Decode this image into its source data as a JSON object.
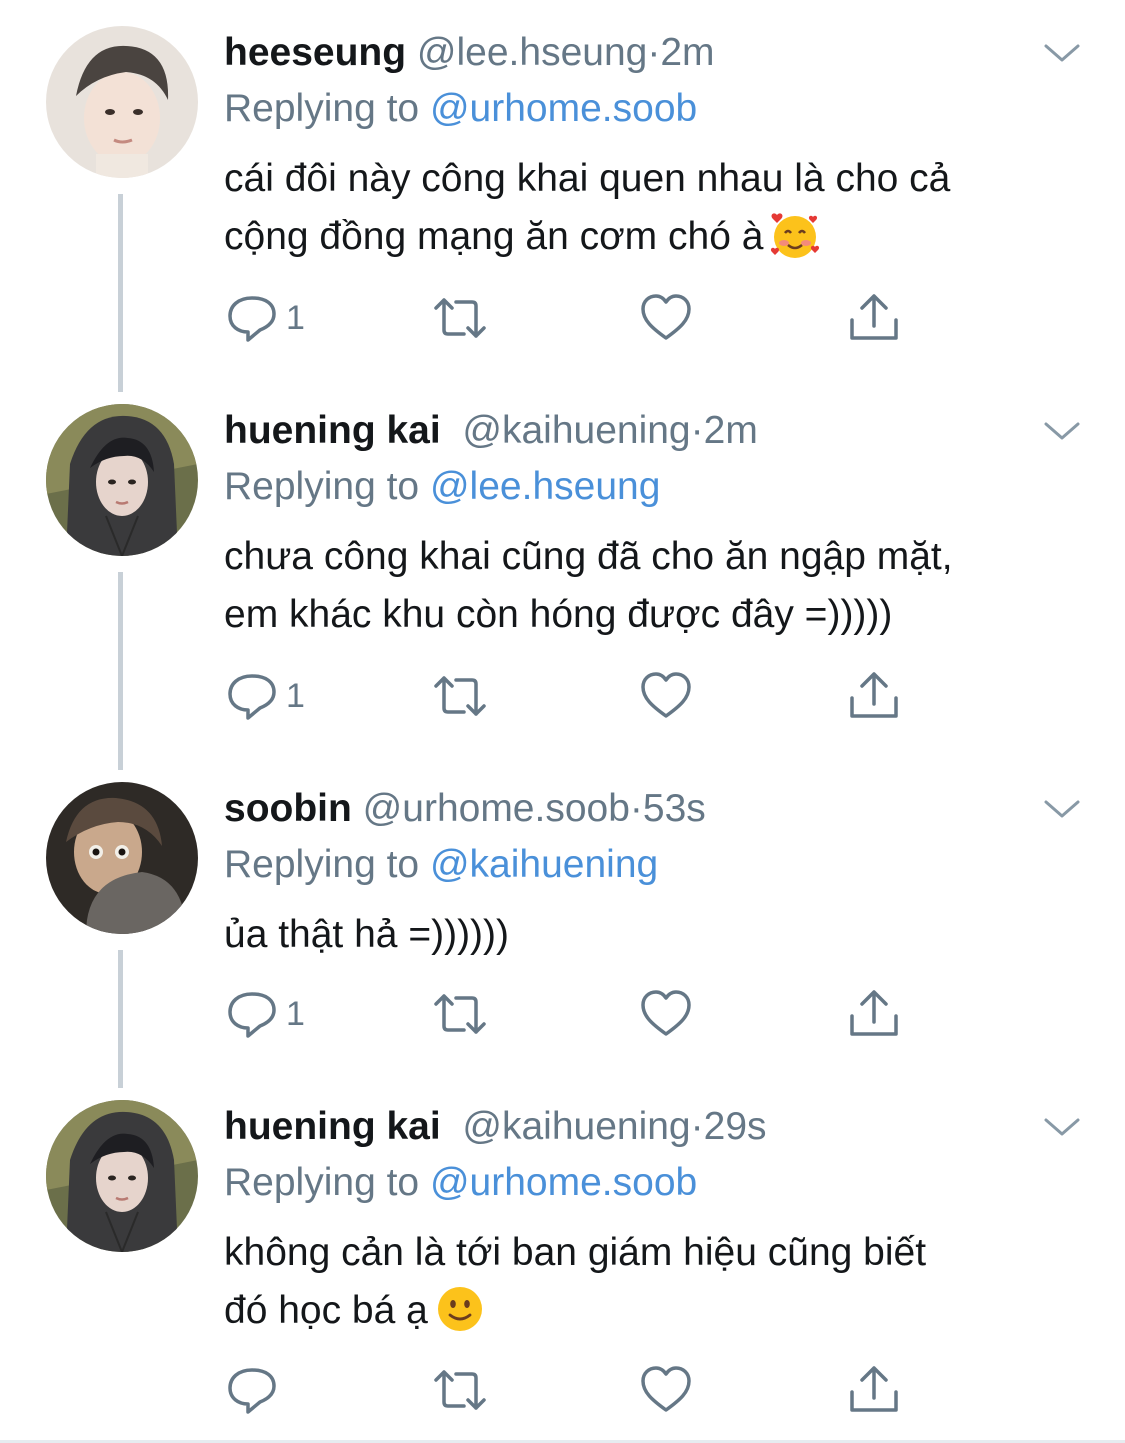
{
  "colors": {
    "name": "#14171a",
    "muted": "#657786",
    "link": "#4a90d9",
    "thread_line": "#c8d0d7"
  },
  "icons": {
    "reply": "reply-icon",
    "retweet": "retweet-icon",
    "like": "heart-icon",
    "share": "share-icon",
    "more": "chevron-down-icon"
  },
  "tweets": [
    {
      "name": "heeseung",
      "handle": "@lee.hseung",
      "dot": "·",
      "time": "2m",
      "replying_prefix": "Replying to",
      "replying_to": "@urhome.soob",
      "text_lines": [
        "cái đôi này công khai quen nhau là cho cả",
        "cộng đồng mạng ăn cơm chó à"
      ],
      "emoji": "smiling-face-with-hearts",
      "reply_count": "1"
    },
    {
      "name": "huening kai",
      "handle": "@kaihuening",
      "dot": "·",
      "time": "2m",
      "replying_prefix": "Replying to",
      "replying_to": "@lee.hseung",
      "text_lines": [
        "chưa công khai cũng đã cho ăn ngập mặt,",
        "em khác khu còn hóng được đây =)))))"
      ],
      "emoji": "",
      "reply_count": "1"
    },
    {
      "name": "soobin",
      "handle": "@urhome.soob",
      "dot": "·",
      "time": "53s",
      "replying_prefix": "Replying to",
      "replying_to": "@kaihuening",
      "text_lines": [
        "ủa thật hả =))))))"
      ],
      "emoji": "",
      "reply_count": "1"
    },
    {
      "name": "huening kai",
      "handle": "@kaihuening",
      "dot": "·",
      "time": "29s",
      "replying_prefix": "Replying to",
      "replying_to": "@urhome.soob",
      "text_lines": [
        "không cản là tới ban giám hiệu cũng biết",
        "đó học bá ạ"
      ],
      "emoji": "slightly-smiling-face",
      "reply_count": ""
    }
  ]
}
